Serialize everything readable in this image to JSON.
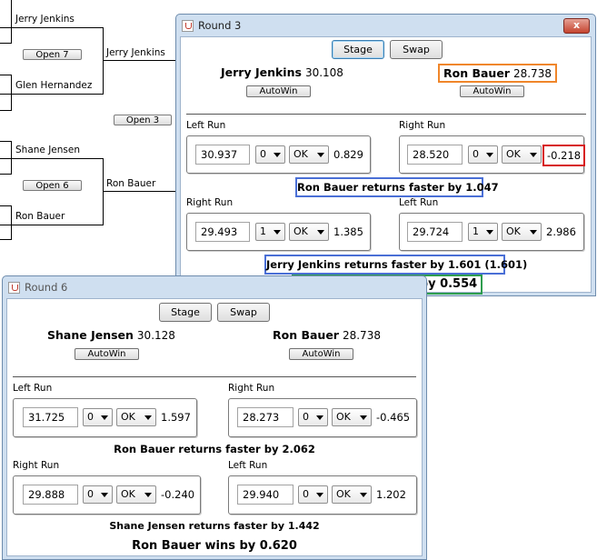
{
  "bracket": {
    "names": {
      "top_1": "Jerry Jenkins",
      "top_2": "Glen Hernandez",
      "top_3": "Jerry Jenkins",
      "bot_1": "Shane Jensen",
      "bot_2": "Ron Bauer",
      "bot_3": "Ron Bauer"
    },
    "buttons": {
      "open7": "Open 7",
      "open6": "Open 6",
      "open3": "Open 3"
    }
  },
  "round3": {
    "title": "Round 3",
    "close_symbol": "x",
    "stage_label": "Stage",
    "swap_label": "Swap",
    "left_racer": {
      "name": "Jerry Jenkins",
      "time": "30.108",
      "autowin": "AutoWin"
    },
    "right_racer": {
      "name": "Ron Bauer",
      "time": "28.738",
      "autowin": "AutoWin"
    },
    "runs": [
      {
        "label": "Left Run",
        "time": "30.937",
        "count": "0",
        "status": "OK",
        "diff": "0.829"
      },
      {
        "label": "Right Run",
        "time": "28.520",
        "count": "0",
        "status": "OK",
        "diff": "-0.218"
      },
      {
        "label": "Right Run",
        "time": "29.493",
        "count": "1",
        "status": "OK",
        "diff": "1.385"
      },
      {
        "label": "Left Run",
        "time": "29.724",
        "count": "1",
        "status": "OK",
        "diff": "2.986"
      }
    ],
    "result_1": "Ron Bauer returns faster by 1.047",
    "result_2": "Jerry Jenkins returns faster by 1.601 (1.601)",
    "winner": "Jerry Jenkins wins by 0.554",
    "highlight_colors": {
      "orange": "#f0862a",
      "red": "#d7191c",
      "blue": "#4a6fd6",
      "green": "#2e9d4e"
    }
  },
  "round6": {
    "title": "Round 6",
    "stage_label": "Stage",
    "swap_label": "Swap",
    "left_racer": {
      "name": "Shane Jensen",
      "time": "30.128",
      "autowin": "AutoWin"
    },
    "right_racer": {
      "name": "Ron Bauer",
      "time": "28.738",
      "autowin": "AutoWin"
    },
    "runs": [
      {
        "label": "Left Run",
        "time": "31.725",
        "count": "0",
        "status": "OK",
        "diff": "1.597"
      },
      {
        "label": "Right Run",
        "time": "28.273",
        "count": "0",
        "status": "OK",
        "diff": "-0.465"
      },
      {
        "label": "Right Run",
        "time": "29.888",
        "count": "0",
        "status": "OK",
        "diff": "-0.240"
      },
      {
        "label": "Left Run",
        "time": "29.940",
        "count": "0",
        "status": "OK",
        "diff": "1.202"
      }
    ],
    "result_1": "Ron Bauer returns faster by 2.062",
    "result_2": "Shane Jensen returns faster by 1.442",
    "winner": "Ron Bauer wins by 0.620"
  }
}
